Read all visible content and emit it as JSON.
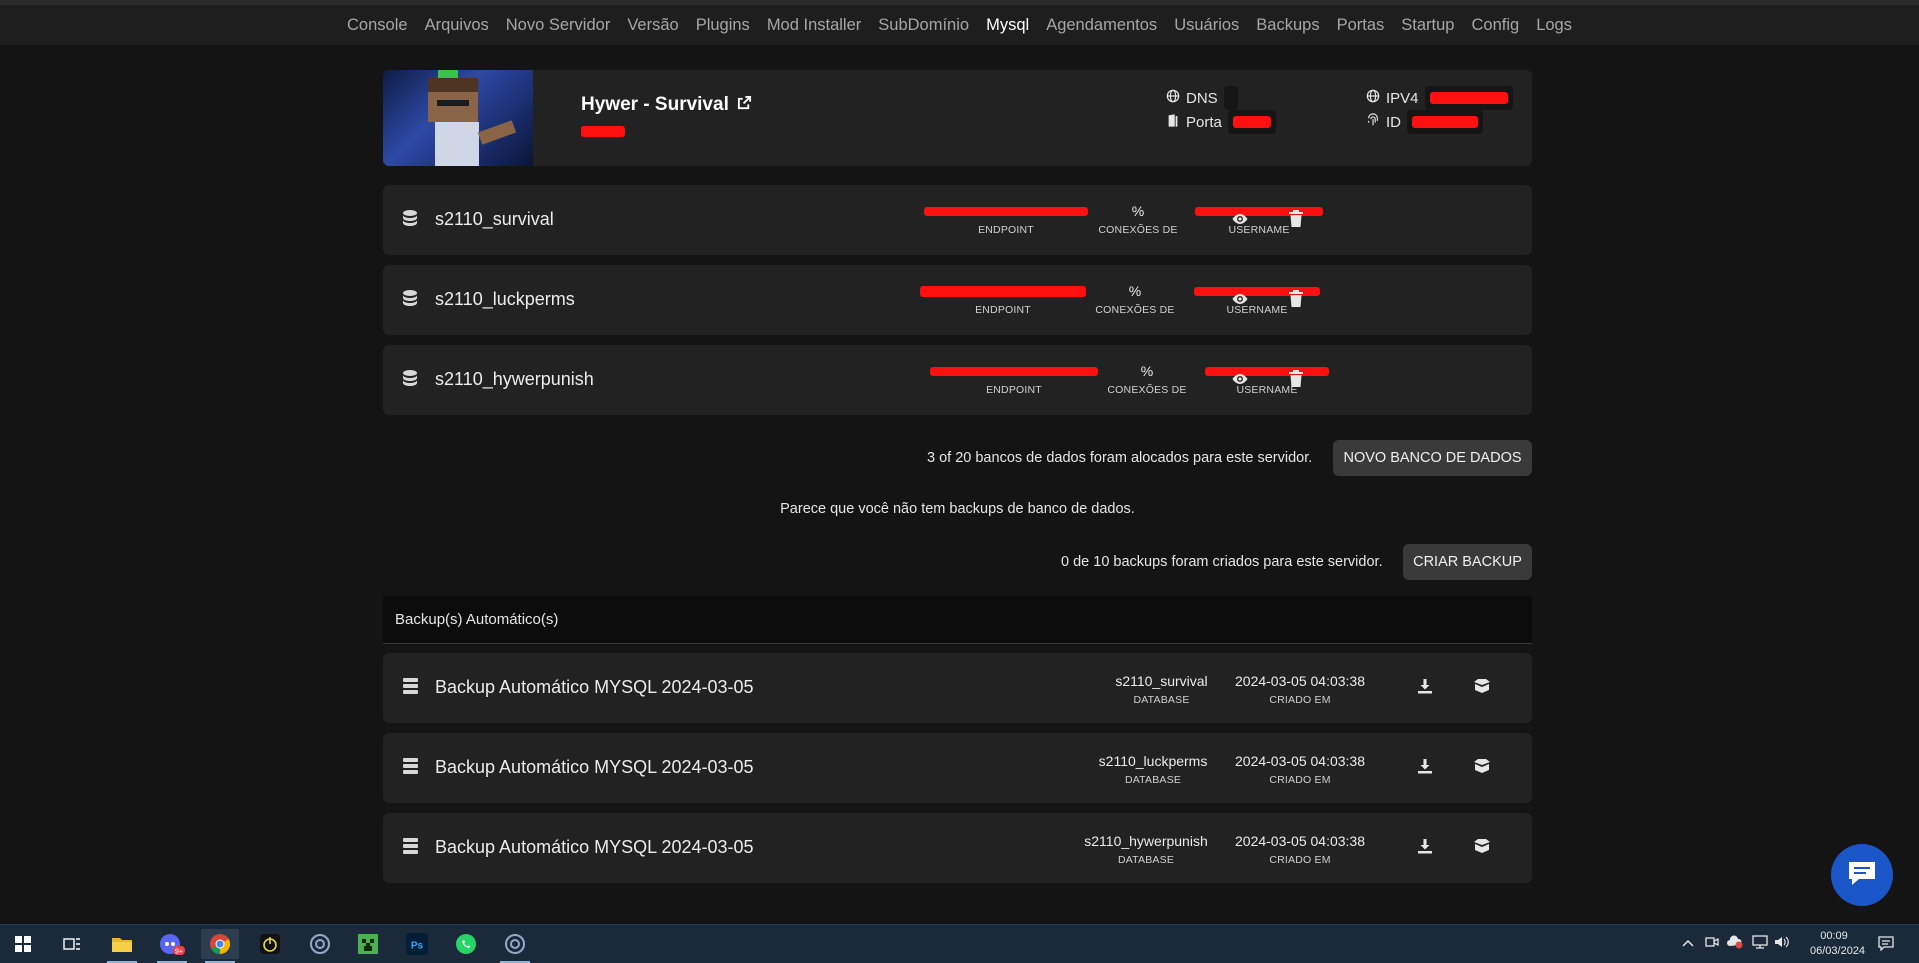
{
  "nav": {
    "items": [
      "Console",
      "Arquivos",
      "Novo Servidor",
      "Versão",
      "Plugins",
      "Mod Installer",
      "SubDomínio",
      "Mysql",
      "Agendamentos",
      "Usuários",
      "Backups",
      "Portas",
      "Startup",
      "Config",
      "Logs"
    ],
    "active": "Mysql"
  },
  "server": {
    "name": "Hywer - Survival",
    "dns_label": "DNS",
    "ipv4_label": "IPV4",
    "port_label": "Porta",
    "id_label": "ID"
  },
  "databases": {
    "columns": {
      "endpoint": "ENDPOINT",
      "connections_value": "%",
      "connections": "CONEXÕES DE",
      "username": "USERNAME"
    },
    "items": [
      {
        "name": "s2110_survival"
      },
      {
        "name": "s2110_luckperms"
      },
      {
        "name": "s2110_hywerpunish"
      }
    ],
    "summary": "3 of 20 bancos de dados foram alocados para este servidor.",
    "new_button": "NOVO BANCO DE DADOS"
  },
  "backups": {
    "empty_message": "Parece que você não tem backups de banco de dados.",
    "summary": "0 de 10 backups foram criados para este servidor.",
    "create_button": "CRIAR BACKUP"
  },
  "auto_backups": {
    "header": "Backup(s) Automático(s)",
    "database_label": "DATABASE",
    "created_label": "CRIADO EM",
    "items": [
      {
        "name": "Backup Automático MYSQL 2024-03-05",
        "database": "s2110_survival",
        "created": "2024-03-05 04:03:38"
      },
      {
        "name": "Backup Automático MYSQL 2024-03-05",
        "database": "s2110_luckperms",
        "created": "2024-03-05 04:03:38"
      },
      {
        "name": "Backup Automático MYSQL 2024-03-05",
        "database": "s2110_hywerpunish",
        "created": "2024-03-05 04:03:38"
      }
    ]
  },
  "taskbar": {
    "badge": "9+",
    "time": "00:09",
    "date": "06/03/2024"
  },
  "colors": {
    "redaction": "#ff1010",
    "chat": "#1a56c8",
    "card": "#222222",
    "background": "#141414"
  }
}
